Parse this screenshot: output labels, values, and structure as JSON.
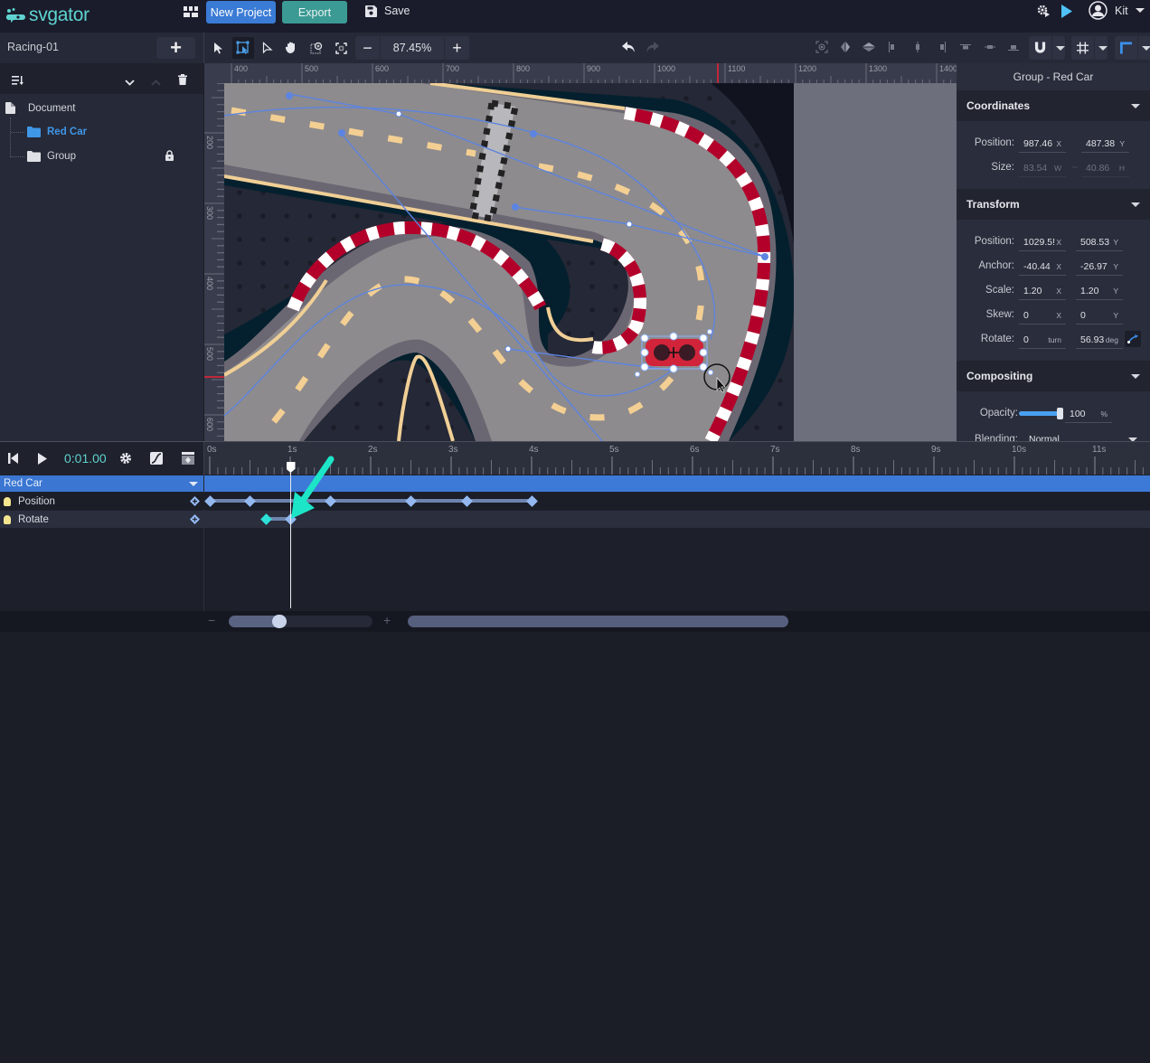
{
  "app": {
    "logo_text": "svgator",
    "new_project_label": "New Project",
    "export_label": "Export",
    "save_label": "Save",
    "user_name": "Kit",
    "brand_color": "#5fd3d0",
    "accent_color": "#3a7bd5"
  },
  "project": {
    "name": "Racing-01"
  },
  "toolbar": {
    "zoom_value": "87.45%",
    "zoom_out_label": "−",
    "zoom_in_label": "+"
  },
  "layers": {
    "items": [
      {
        "label": "Document",
        "icon": "document-icon",
        "selected": false
      },
      {
        "label": "Red Car",
        "icon": "folder-icon",
        "selected": true
      },
      {
        "label": "Group",
        "icon": "folder-icon",
        "selected": false,
        "locked": true
      }
    ]
  },
  "ruler": {
    "horizontal": [
      "400",
      "500",
      "600",
      "700",
      "800",
      "900",
      "1000",
      "1100",
      "1200",
      "1300",
      "1400"
    ],
    "vertical": [
      "200",
      "300",
      "400",
      "500",
      "600"
    ]
  },
  "properties": {
    "title": "Group - Red Car",
    "coordinates": {
      "heading": "Coordinates",
      "position_label": "Position:",
      "position_x": "987.46",
      "position_x_unit": "X",
      "position_y": "487.38",
      "position_y_unit": "Y",
      "size_label": "Size:",
      "size_w": "83.54",
      "size_w_unit": "W",
      "size_h": "40.86",
      "size_h_unit": "H"
    },
    "transform": {
      "heading": "Transform",
      "position_label": "Position:",
      "position_x": "1029.5!",
      "position_y": "508.53",
      "anchor_label": "Anchor:",
      "anchor_x": "-40.44",
      "anchor_y": "-26.97",
      "scale_label": "Scale:",
      "scale_x": "1.20",
      "scale_y": "1.20",
      "skew_label": "Skew:",
      "skew_x": "0",
      "skew_y": "0",
      "rotate_label": "Rotate:",
      "rotate_turn": "0",
      "rotate_turn_unit": "turn",
      "rotate_deg": "56.93",
      "rotate_deg_unit": "deg",
      "x_unit": "X",
      "y_unit": "Y"
    },
    "compositing": {
      "heading": "Compositing",
      "opacity_label": "Opacity:",
      "opacity_value": "100",
      "opacity_unit": "%",
      "opacity_fraction": 1.0,
      "blending_label": "Blending:",
      "blending_value": "Normal"
    }
  },
  "timeline": {
    "current_time": "0:01.00",
    "time_labels": [
      "0s",
      "1s",
      "2s",
      "3s",
      "4s",
      "5s",
      "6s",
      "7s",
      "8s",
      "9s",
      "10s",
      "11s"
    ],
    "playhead_seconds": 1.0,
    "group_label": "Red Car",
    "tracks": [
      {
        "label": "Position",
        "keyframes_seconds": [
          0,
          0.5,
          1.5,
          2.5,
          3.2,
          4.0
        ]
      },
      {
        "label": "Rotate",
        "keyframes_seconds": [
          0.7,
          1.0
        ],
        "highlight_index": 0
      }
    ],
    "zoom_minus": "−",
    "zoom_plus": "+",
    "zoom_slider_fraction": 0.35
  }
}
